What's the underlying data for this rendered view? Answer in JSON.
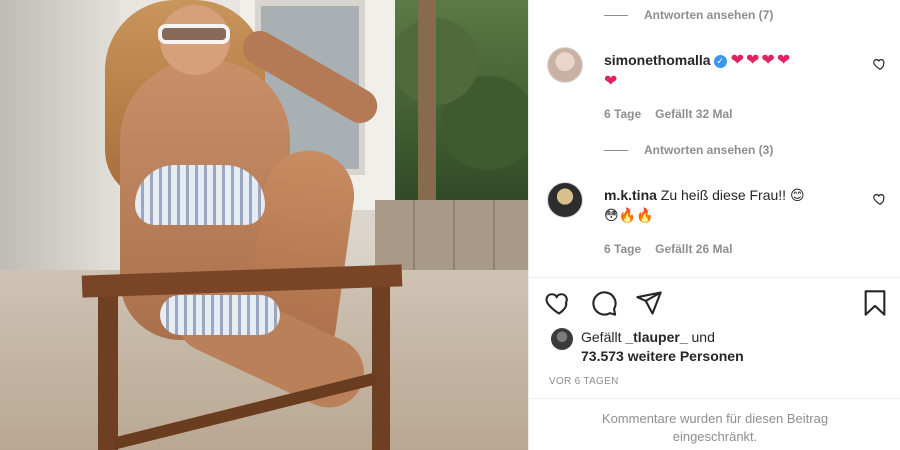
{
  "comments": {
    "view_replies_1": "Antworten ansehen (7)",
    "comment_1": {
      "username": "simonethomalla",
      "verified": true,
      "text_line1": "❤❤❤❤",
      "text_line2": "❤",
      "age": "6 Tage",
      "likes": "Gefällt 32 Mal"
    },
    "view_replies_2": "Antworten ansehen (3)",
    "comment_2": {
      "username": "m.k.tina",
      "text_line1": "Zu heiß diese Frau!! 😊",
      "text_line2": "😳🔥🔥",
      "age": "6 Tage",
      "likes": "Gefällt 26 Mal"
    }
  },
  "actions": {
    "like_icon": "heart-outline-icon",
    "comment_icon": "speech-bubble-icon",
    "share_icon": "paper-plane-icon",
    "save_icon": "bookmark-icon"
  },
  "likes": {
    "prefix": "Gefällt",
    "user": "_tlauper_",
    "connector": "und",
    "others": "73.573 weitere Personen"
  },
  "timestamp": "VOR 6 TAGEN",
  "restricted_note": "Kommentare wurden für diesen Beitrag eingeschränkt.",
  "colors": {
    "text": "#262626",
    "muted": "#8e8e8e",
    "verified_blue": "#3897f0",
    "heart_red": "#e0245e"
  }
}
